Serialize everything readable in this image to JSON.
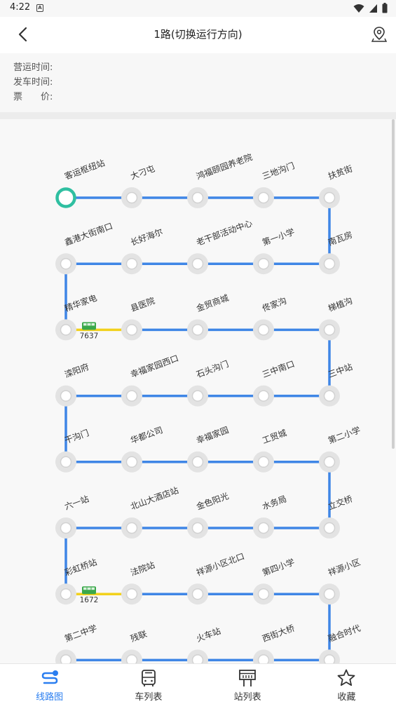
{
  "status_bar": {
    "time": "4:22",
    "notif_icon": "a-icon",
    "icons": [
      "wifi-icon",
      "signal-icon",
      "battery-icon"
    ]
  },
  "header": {
    "back_icon": "back-arrow-icon",
    "title": "1路(切换运行方向)",
    "map_icon": "map-pin-icon"
  },
  "info": {
    "hours_label": "营运时间:",
    "hours_value": "",
    "depart_label": "发车时间:",
    "depart_value": "",
    "fare_label": "票　　价:",
    "fare_value": ""
  },
  "colors": {
    "line": "#3f86e6",
    "bus_segment": "#f2d11c",
    "current_stop": "#2fbfa1",
    "stop": "#e3e3e3",
    "bus": "#3aa84a",
    "accent": "#2a7ef0"
  },
  "route": {
    "stops_per_row": 5,
    "stops": [
      "客运枢纽站",
      "大刁屯",
      "鸿福颐园养老院",
      "三地沟门",
      "扶贫街",
      "南瓦房",
      "第一小学",
      "老干部活动中心",
      "长好海尔",
      "鑫港大街南口",
      "精华家电",
      "县医院",
      "金贸商城",
      "佟家沟",
      "梯植沟",
      "三中站",
      "三中南口",
      "石头沟门",
      "幸福家园西口",
      "滦阳府",
      "干沟门",
      "华都公司",
      "幸福家园",
      "工贸城",
      "第二小学",
      "立交桥",
      "水务局",
      "金色阳光",
      "北山大酒店站",
      "六一站",
      "彩虹桥站",
      "法院站",
      "祥源小区北口",
      "第四小学",
      "祥源小区",
      "融合时代",
      "西街大桥",
      "火车站",
      "残联",
      "第二中学"
    ],
    "current_stop_index": 0,
    "buses": [
      {
        "id": "7637",
        "segment": 10
      },
      {
        "id": "1672",
        "segment": 30
      }
    ]
  },
  "tabs": [
    {
      "label": "线路图",
      "icon": "route-map-icon",
      "active": true
    },
    {
      "label": "车列表",
      "icon": "bus-icon",
      "active": false
    },
    {
      "label": "站列表",
      "icon": "stop-board-icon",
      "active": false
    },
    {
      "label": "收藏",
      "icon": "star-icon",
      "active": false
    }
  ]
}
